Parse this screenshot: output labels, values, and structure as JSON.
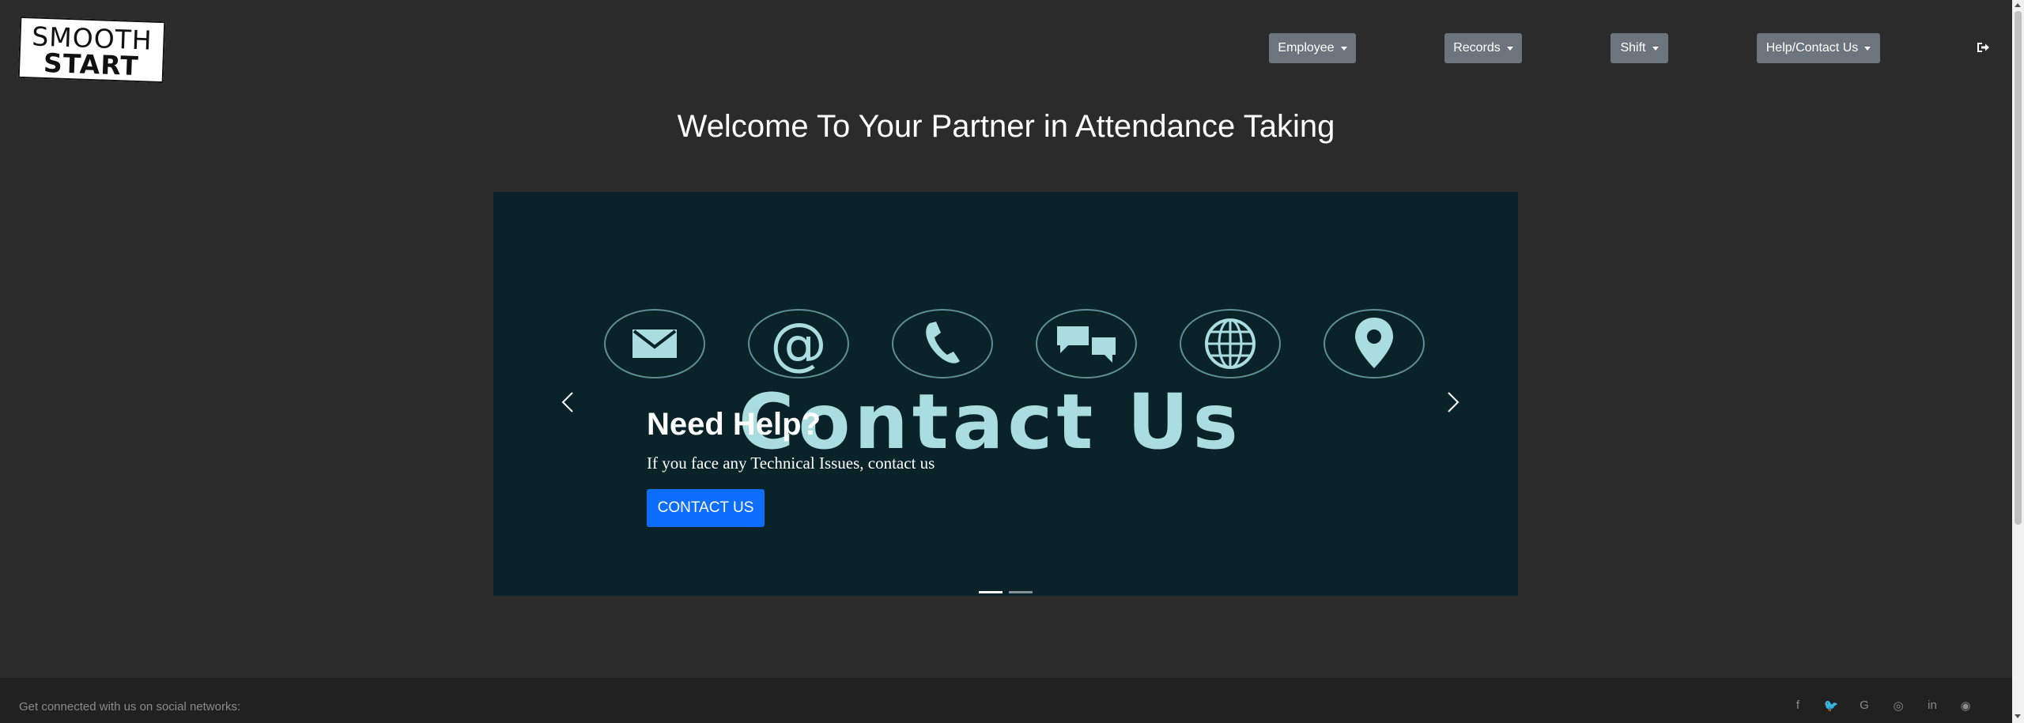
{
  "header": {
    "logo": {
      "line1": "SMOOTH",
      "line2": "START"
    },
    "nav": [
      {
        "label": "Employee"
      },
      {
        "label": "Records"
      },
      {
        "label": "Shift"
      },
      {
        "label": "Help/Contact Us"
      }
    ],
    "logout_icon": "sign-out-icon"
  },
  "main": {
    "welcome_title": "Welcome To Your Partner in Attendance Taking",
    "carousel": {
      "image_text": "Contact Us",
      "image_icons": [
        "envelope-icon",
        "at-sign-icon",
        "phone-icon",
        "chat-icon",
        "globe-icon",
        "location-pin-icon"
      ],
      "caption_title": "Need Help?",
      "caption_text": "If you face any Technical Issues, contact us",
      "cta_label": "CONTACT US",
      "slide_count": 2,
      "active_slide": 1
    }
  },
  "footer": {
    "text": "Get connected with us on social networks:",
    "social": [
      {
        "icon": "facebook-icon",
        "glyph": "f"
      },
      {
        "icon": "twitter-icon",
        "glyph": "🐦"
      },
      {
        "icon": "google-icon",
        "glyph": "G"
      },
      {
        "icon": "instagram-icon",
        "glyph": "◎"
      },
      {
        "icon": "linkedin-icon",
        "glyph": "in"
      },
      {
        "icon": "github-icon",
        "glyph": "◉"
      }
    ]
  },
  "colors": {
    "background": "#2b2b2b",
    "nav_button": "#6c757d",
    "cta": "#0d6efd",
    "carousel_bg": "#0a2329",
    "footer_bg": "#212121"
  }
}
